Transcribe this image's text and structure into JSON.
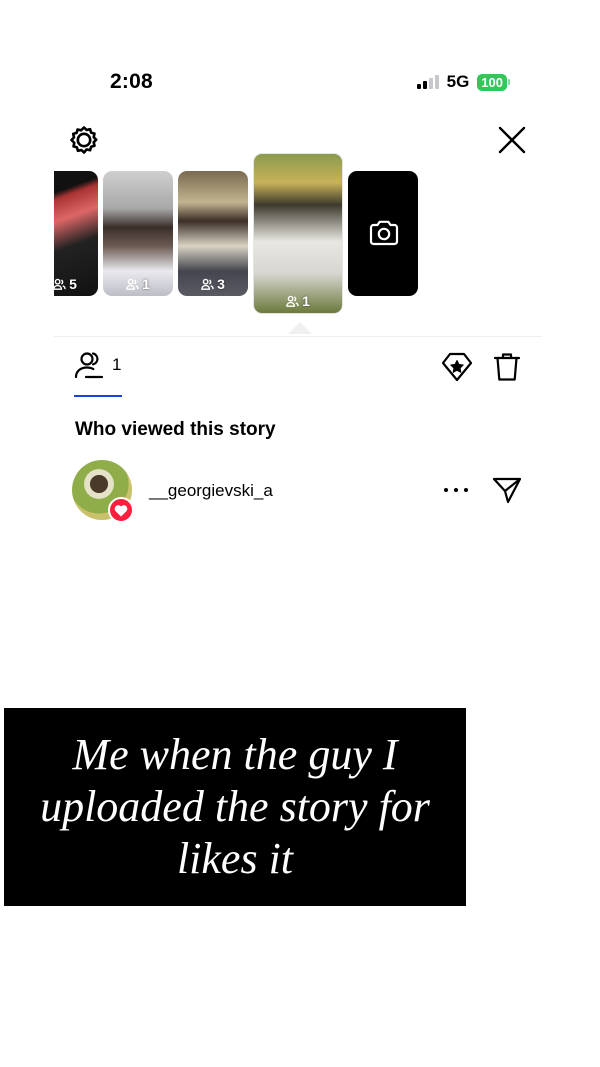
{
  "status_bar": {
    "time": "2:08",
    "network": "5G",
    "battery": "100",
    "battery_color": "#33c759"
  },
  "top_bar": {
    "settings_icon": "gear-icon",
    "close_icon": "close-icon"
  },
  "stories": [
    {
      "viewers": "5",
      "active": false
    },
    {
      "viewers": "1",
      "active": false
    },
    {
      "viewers": "3",
      "active": false
    },
    {
      "viewers": "1",
      "active": true
    },
    {
      "type": "add-story",
      "icon": "camera-icon"
    }
  ],
  "tabs": {
    "viewers_count": "1",
    "accent_color": "#1d3fe0",
    "highlight_icon": "diamond-star-icon",
    "delete_icon": "trash-icon"
  },
  "section": {
    "title": "Who viewed this story"
  },
  "viewers": [
    {
      "username": "__georgievski_a",
      "liked": true,
      "like_color": "#ff1f3d"
    }
  ],
  "caption": {
    "text": "Me when the guy I uploaded the story for likes it"
  }
}
